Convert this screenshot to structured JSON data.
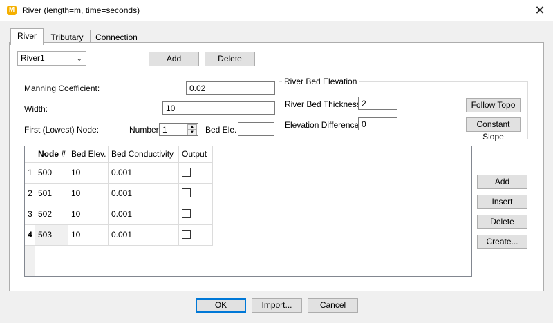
{
  "window": {
    "title": "River (length=m, time=seconds)",
    "close_glyph": "✕"
  },
  "tabs": [
    {
      "label": "River"
    },
    {
      "label": "Tributary"
    },
    {
      "label": "Connection"
    }
  ],
  "river": {
    "selected": "River1",
    "add_label": "Add",
    "delete_label": "Delete"
  },
  "properties": {
    "manning_label": "Manning Coefficient:",
    "manning_value": "0.02",
    "width_label": "Width:",
    "width_value": "10",
    "first_node_label": "First (Lowest) Node:",
    "number_label": "Number",
    "number_value": "1",
    "bed_ele_label": "Bed Ele.",
    "bed_ele_value": ""
  },
  "bed_elevation": {
    "title": "River Bed Elevation",
    "thickness_label": "River Bed Thickness:",
    "thickness_value": "2",
    "diff_label": "Elevation Difference:",
    "diff_value": "0",
    "follow_topo_label": "Follow Topo",
    "constant_slope_label": "Constant Slope"
  },
  "table": {
    "columns": [
      "Node #",
      "Bed Elev.",
      "Bed Conductivity",
      "Output"
    ],
    "rows": [
      {
        "num": "1",
        "node": "500",
        "elev": "10",
        "cond": "0.001"
      },
      {
        "num": "2",
        "node": "501",
        "elev": "10",
        "cond": "0.001"
      },
      {
        "num": "3",
        "node": "502",
        "elev": "10",
        "cond": "0.001"
      },
      {
        "num": "4",
        "node": "503",
        "elev": "10",
        "cond": "0.001"
      }
    ]
  },
  "side_buttons": {
    "add": "Add",
    "insert": "Insert",
    "delete": "Delete",
    "create": "Create..."
  },
  "footer": {
    "ok": "OK",
    "import": "Import...",
    "cancel": "Cancel"
  }
}
